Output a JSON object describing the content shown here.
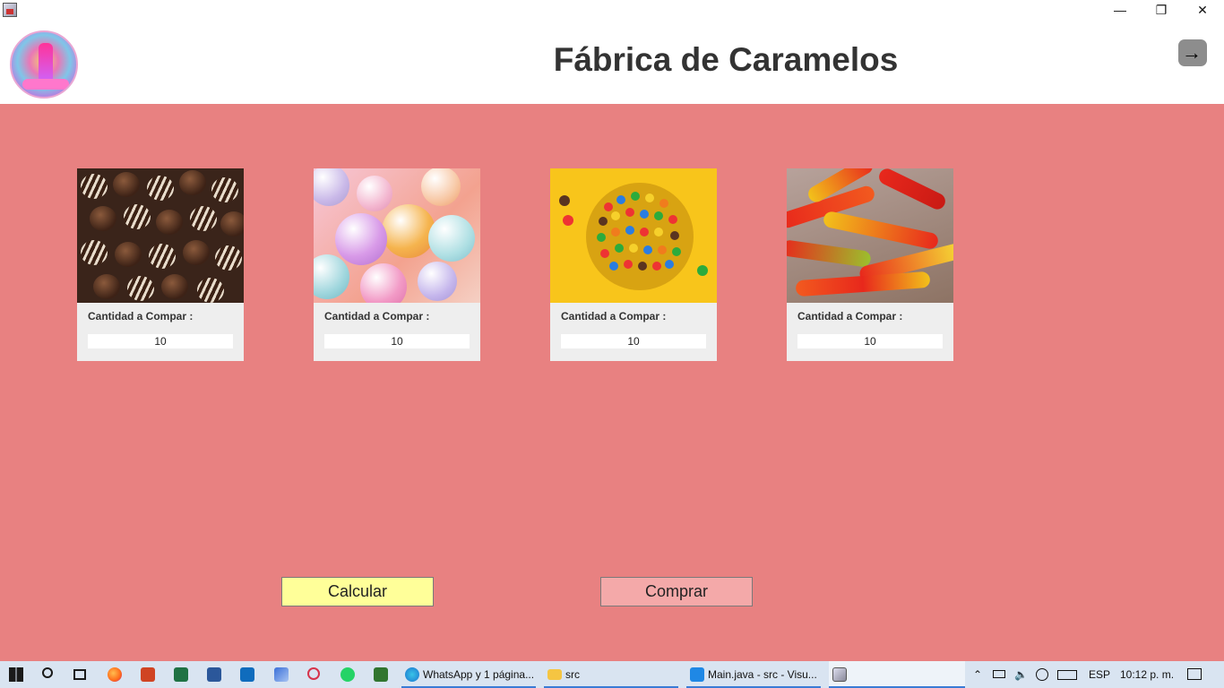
{
  "window": {
    "minimize": "—",
    "maximize": "❐",
    "close": "✕"
  },
  "header": {
    "title": "Fábrica de Caramelos",
    "logout_icon": "→"
  },
  "products": [
    {
      "label": "Cantidad a Compar :",
      "quantity": "10",
      "image": "chocolate truffles"
    },
    {
      "label": "Cantidad a Compar :",
      "quantity": "10",
      "image": "candy balls"
    },
    {
      "label": "Cantidad a Compar :",
      "quantity": "10",
      "image": "M&M candies bowl"
    },
    {
      "label": "Cantidad a Compar :",
      "quantity": "10",
      "image": "gummy worms"
    }
  ],
  "actions": {
    "calculate": "Calcular",
    "buy": "Comprar"
  },
  "colors": {
    "background": "#e88181",
    "calculate_button": "#ffff99",
    "buy_button": "#f4a9a9",
    "card": "#eeeeee"
  },
  "taskbar": {
    "tasks": [
      {
        "label": "WhatsApp y 1 página..."
      },
      {
        "label": "src"
      },
      {
        "label": "Main.java - src - Visu..."
      },
      {
        "label": ""
      }
    ],
    "language": "ESP",
    "time": "10:12 p. m."
  }
}
